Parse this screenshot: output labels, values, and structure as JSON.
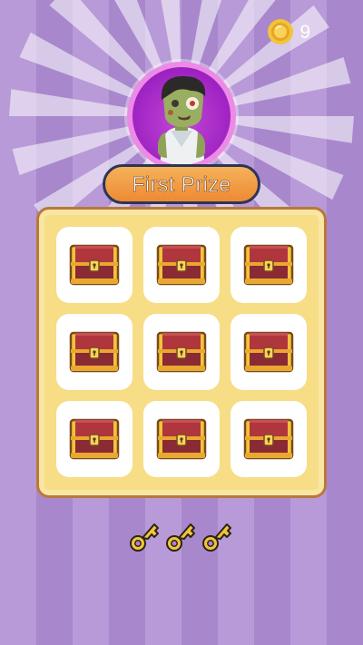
{
  "header": {
    "coin_count": "9",
    "coin_icon": "gold-coin-icon"
  },
  "prize": {
    "label": "First Prize",
    "character": "zombie-character"
  },
  "board": {
    "chests": [
      {
        "state": "closed"
      },
      {
        "state": "closed"
      },
      {
        "state": "closed"
      },
      {
        "state": "closed"
      },
      {
        "state": "closed"
      },
      {
        "state": "closed"
      },
      {
        "state": "closed"
      },
      {
        "state": "closed"
      },
      {
        "state": "closed"
      }
    ]
  },
  "keys": {
    "remaining": 3,
    "icon": "gold-key-icon"
  },
  "colors": {
    "background_stripe_a": "#b89ad8",
    "background_stripe_b": "#a887cc",
    "banner_orange": "#ee8a34",
    "board_yellow": "#f6dd86",
    "chest_red": "#b0363d",
    "gold": "#f3c33a"
  }
}
